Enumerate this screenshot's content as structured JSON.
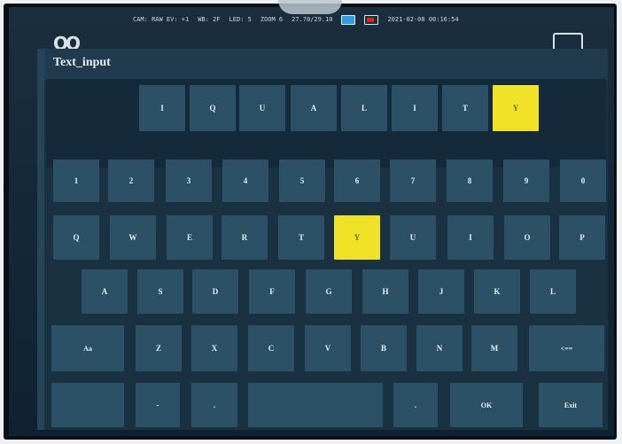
{
  "status_bar": {
    "cam": "CAM: RAW EV: +1",
    "wb": "WB: 2F",
    "led": "LED: 5",
    "zoom": "ZOOM 6",
    "value": "27.70/29.10",
    "datetime": "2021-02-08 00:16:54"
  },
  "dialog": {
    "title": "Text_input"
  },
  "input_chars": [
    "I",
    "Q",
    "U",
    "A",
    "L",
    "I",
    "T",
    "Y"
  ],
  "keyboard": {
    "row1": [
      "1",
      "2",
      "3",
      "4",
      "5",
      "6",
      "7",
      "8",
      "9",
      "0"
    ],
    "row2": [
      "Q",
      "W",
      "E",
      "R",
      "T",
      "Y",
      "U",
      "I",
      "O",
      "P"
    ],
    "row3": [
      "A",
      "S",
      "D",
      "F",
      "G",
      "H",
      "J",
      "K",
      "L"
    ],
    "row4": [
      "Aa",
      "Z",
      "X",
      "C",
      "V",
      "B",
      "N",
      "M",
      "<=="
    ],
    "row5": [
      "",
      "-",
      ".",
      "",
      ".",
      "OK",
      "Exit"
    ]
  },
  "highlighted_key": "Y",
  "colors": {
    "key_bg": "#2c5066",
    "highlight": "#f0e327",
    "dialog_bg": "#1a3142"
  }
}
